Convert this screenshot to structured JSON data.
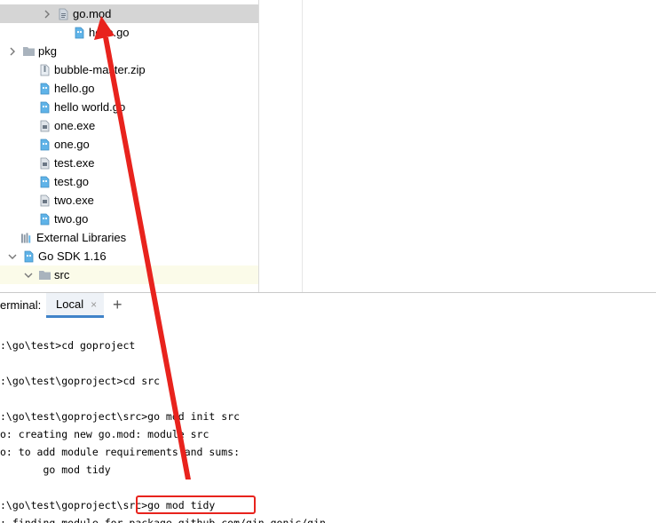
{
  "project_tree": {
    "items": [
      {
        "label": "go.mod",
        "icon": "go-mod-file-icon",
        "expandable": true,
        "selected": true
      },
      {
        "label": "hello.go",
        "icon": "go-file-icon"
      },
      {
        "label": "pkg",
        "icon": "folder-icon",
        "expandable": true
      },
      {
        "label": "bubble-master.zip",
        "icon": "zip-file-icon"
      },
      {
        "label": "hello.go",
        "icon": "go-file-icon"
      },
      {
        "label": "hello world.go",
        "icon": "go-file-icon"
      },
      {
        "label": "one.exe",
        "icon": "exe-file-icon"
      },
      {
        "label": "one.go",
        "icon": "go-file-icon"
      },
      {
        "label": "test.exe",
        "icon": "exe-file-icon"
      },
      {
        "label": "test.go",
        "icon": "go-file-icon"
      },
      {
        "label": "two.exe",
        "icon": "exe-file-icon"
      },
      {
        "label": "two.go",
        "icon": "go-file-icon"
      },
      {
        "label": "External Libraries",
        "icon": "libraries-icon"
      },
      {
        "label": "Go SDK 1.16",
        "icon": "go-sdk-icon",
        "expanded": true
      },
      {
        "label": "src",
        "icon": "folder-icon",
        "expanded": true
      }
    ]
  },
  "terminal": {
    "title": "erminal:",
    "tab_label": "Local",
    "tab_close": "×",
    "add_tab": "+",
    "lines": [
      ":\\go\\test>cd goproject",
      "",
      ":\\go\\test\\goproject>cd src",
      "",
      ":\\go\\test\\goproject\\src>go mod init src",
      "o: creating new go.mod: module src",
      "o: to add module requirements and sums:",
      "       go mod tidy",
      "",
      ":\\go\\test\\goproject\\src>go mod tidy",
      ": finding module for package github.com/gin-gonic/gin"
    ]
  },
  "colors": {
    "selection": "#d5d5d5",
    "highlight_row": "#fbfbe9",
    "annotation_red": "#e8231d",
    "tab_underline": "#4083c9"
  }
}
